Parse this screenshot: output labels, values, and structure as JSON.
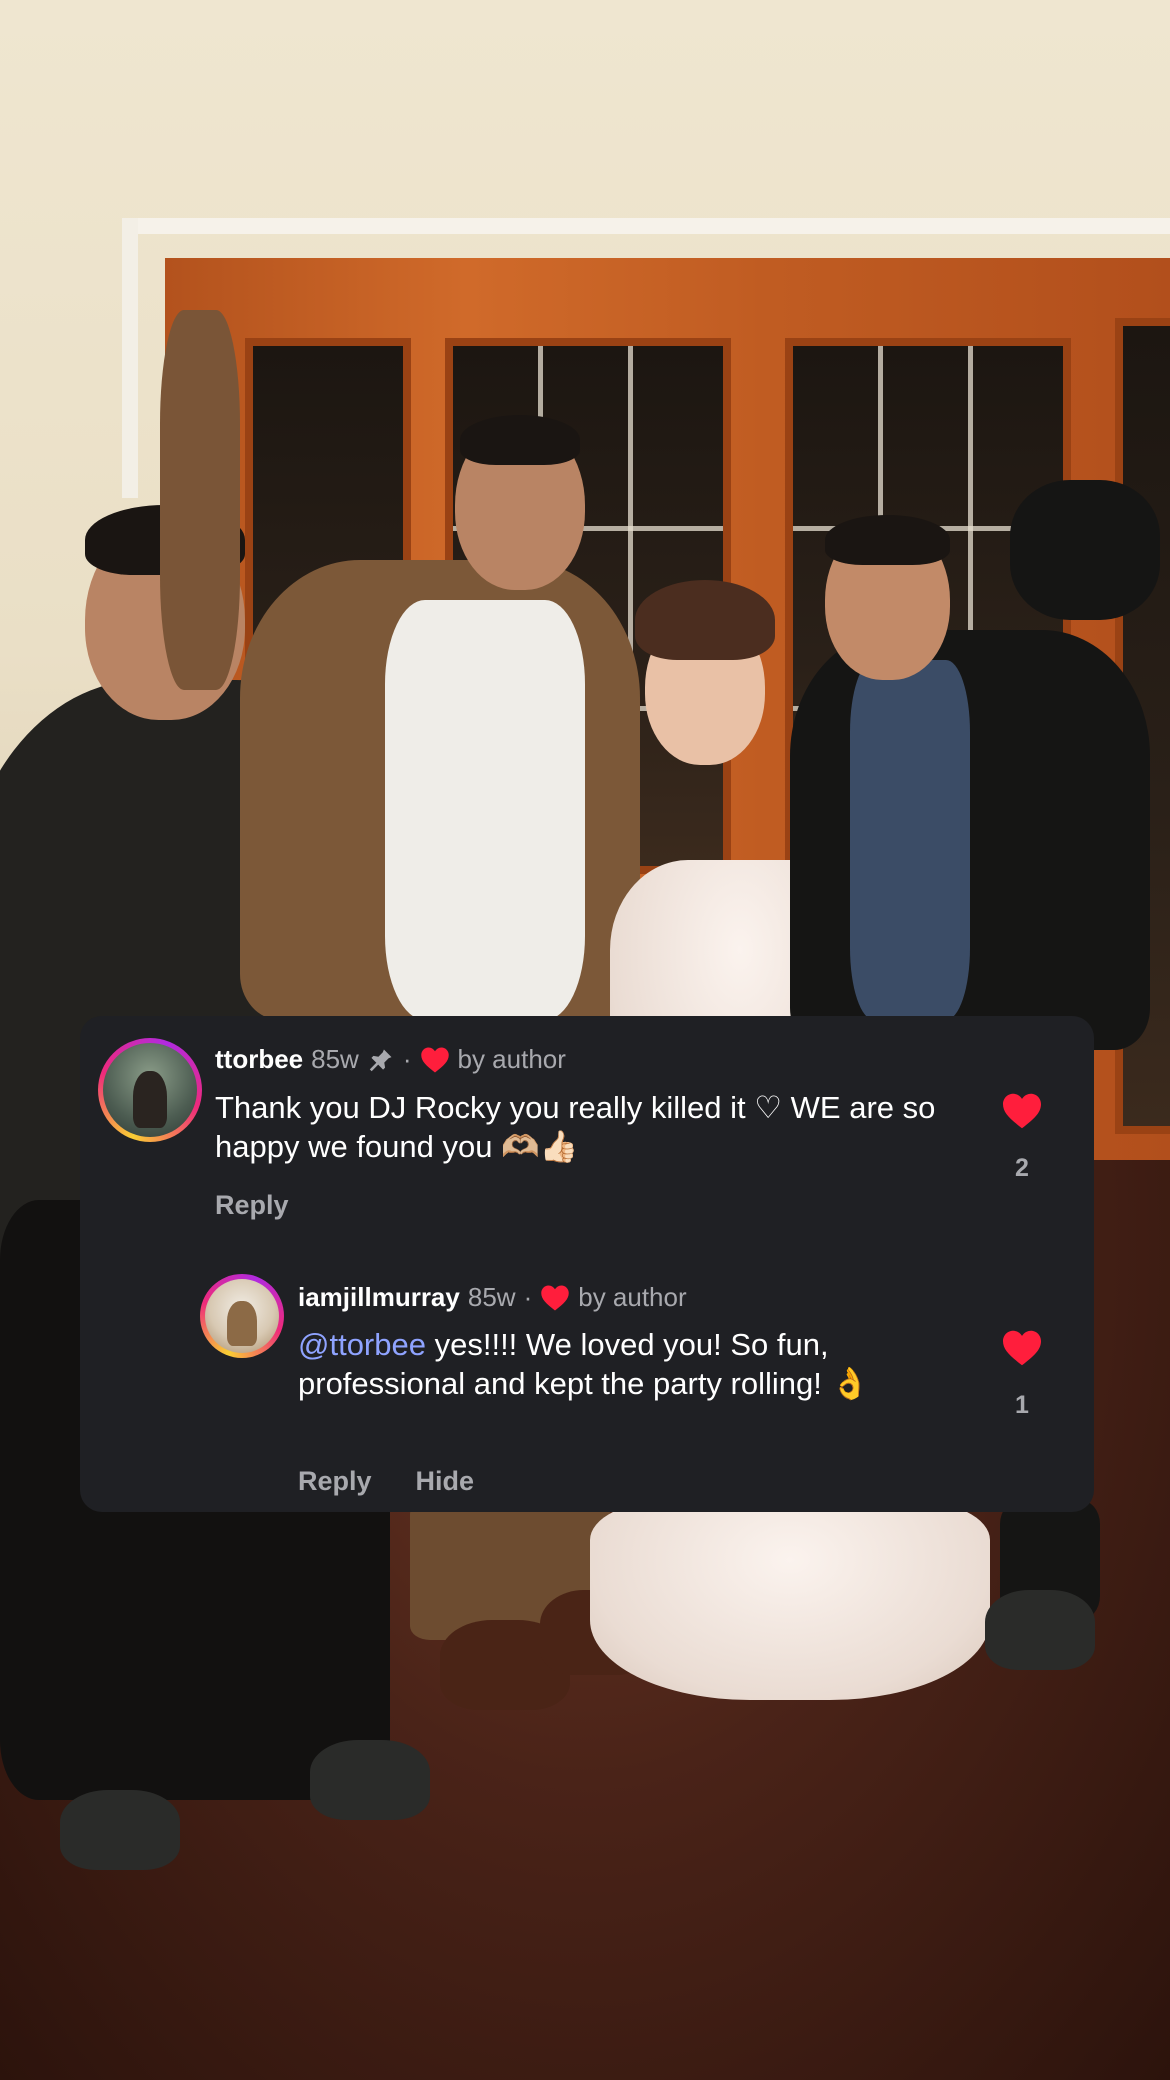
{
  "comments": [
    {
      "username": "ttorbee",
      "age": "85w",
      "separator": "·",
      "liked_by": "by author",
      "text": "Thank you DJ Rocky you really killed it ♡ WE are so happy we found you 🫶🏼👍🏻",
      "reply_label": "Reply",
      "like_count": "2",
      "icons": [
        "pin-icon",
        "heart-icon"
      ]
    },
    {
      "username": "iamjillmurray",
      "age": "85w",
      "separator": "·",
      "liked_by": "by author",
      "mention": "@ttorbee",
      "text": " yes!!!! We loved you! So fun, professional and kept the party rolling! 👌",
      "reply_label": "Reply",
      "hide_label": "Hide",
      "like_count": "1",
      "icons": [
        "heart-icon"
      ]
    }
  ],
  "colors": {
    "card_bg": "#1f2024",
    "heart": "#ff1e3c",
    "mention": "#8fa3ff",
    "muted_text": "#a8a9ae"
  }
}
